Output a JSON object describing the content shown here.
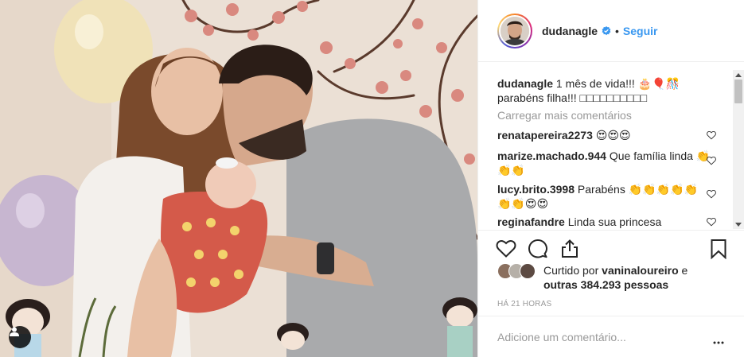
{
  "post": {
    "author": {
      "username": "dudanagle",
      "verified": true,
      "follow_label": "Seguir",
      "separator": "•"
    },
    "caption": {
      "username": "dudanagle",
      "text": "1 mês de vida!!! 🎂🎈🎊 parabéns filha!!! □□□□□□□□□□"
    },
    "load_more_label": "Carregar mais comentários",
    "comments": [
      {
        "username": "renatapereira2273",
        "text": "😍😍😍"
      },
      {
        "username": "marize.machado.944",
        "text": "Que família linda 👏👏👏"
      },
      {
        "username": "lucy.brito.3998",
        "text": "Parabéns 👏👏👏👏👏 👏👏😍😍"
      },
      {
        "username": "reginafandre",
        "text": "Linda sua princesa"
      }
    ],
    "likes": {
      "prefix": "Curtido por",
      "liker": "vaninaloureiro",
      "conjunction": "e",
      "others": "outras 384.293 pessoas"
    },
    "timestamp": "HÁ 21 HORAS",
    "comment_placeholder": "Adicione um comentário...",
    "more_label": "•••",
    "icons": {
      "like": "heart-icon",
      "comment": "comment-bubble-icon",
      "share": "share-icon",
      "save": "bookmark-icon",
      "user_tag": "user-tag-icon",
      "verified": "verified-badge-icon"
    },
    "colors": {
      "link_blue": "#3897f0",
      "verified_blue": "#3897f0",
      "text": "#262626",
      "muted": "#999999",
      "border": "#efefef"
    }
  }
}
